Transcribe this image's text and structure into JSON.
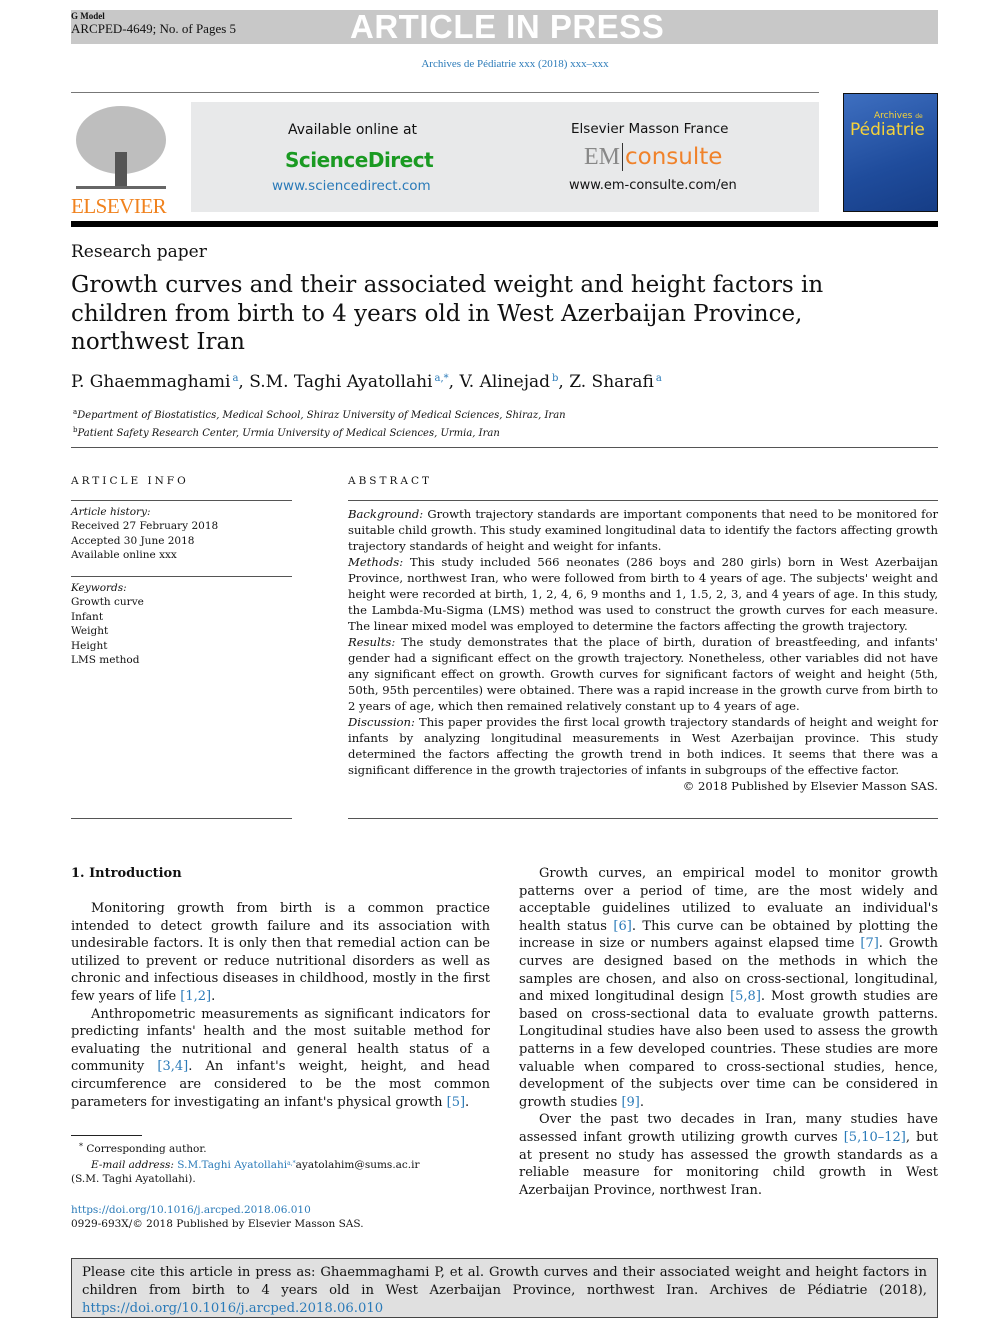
{
  "header": {
    "g_model": "G Model",
    "code": "ARCPED-4649; No. of Pages 5",
    "banner": "ARTICLE IN PRESS",
    "journal_line": "Archives de Pédiatrie xxx (2018) xxx–xxx"
  },
  "masthead": {
    "publisher_logo": "ELSEVIER",
    "available": "Available online at",
    "sciencedirect": "ScienceDirect",
    "sd_url": "www.sciencedirect.com",
    "masson": "Elsevier Masson France",
    "em": "EM",
    "consulte": "consulte",
    "em_url": "www.em-consulte.com/en",
    "cover_title_1": "Archives",
    "cover_title_de": "de",
    "cover_title_2": "Pédiatrie",
    "colors": {
      "sciencedirect": "#1a9a22",
      "link": "#2a7ab8",
      "consulte": "#f0822a",
      "elsevier": "#f0821e"
    }
  },
  "article": {
    "type": "Research paper",
    "title": "Growth curves and their associated weight and height factors in children from birth to 4 years old in West Azerbaijan Province, northwest Iran",
    "authors": [
      {
        "name": "P. Ghaemmaghami",
        "sup": "a"
      },
      {
        "name": "S.M. Taghi Ayatollahi",
        "sup": "a,*"
      },
      {
        "name": "V. Alinejad",
        "sup": "b"
      },
      {
        "name": "Z. Sharafi",
        "sup": "a"
      }
    ],
    "affiliations": [
      {
        "sup": "a",
        "text": "Department of Biostatistics, Medical School, Shiraz University of Medical Sciences, Shiraz, Iran"
      },
      {
        "sup": "b",
        "text": "Patient Safety Research Center, Urmia University of Medical Sciences, Urmia, Iran"
      }
    ]
  },
  "info": {
    "heading": "ARTICLE INFO",
    "history_label": "Article history:",
    "history": [
      "Received 27 February 2018",
      "Accepted 30 June 2018",
      "Available online xxx"
    ],
    "keywords_label": "Keywords:",
    "keywords": [
      "Growth curve",
      "Infant",
      "Weight",
      "Height",
      "LMS method"
    ]
  },
  "abstract": {
    "heading": "ABSTRACT",
    "sections": [
      {
        "label": "Background:",
        "text": " Growth trajectory standards are important components that need to be monitored for suitable child growth. This study examined longitudinal data to identify the factors affecting growth trajectory standards of height and weight for infants."
      },
      {
        "label": "Methods:",
        "text": " This study included 566 neonates (286 boys and 280 girls) born in West Azerbaijan Province, northwest Iran, who were followed from birth to 4 years of age. The subjects' weight and height were recorded at birth, 1, 2, 4, 6, 9 months and 1, 1.5, 2, 3, and 4 years of age. In this study, the Lambda-Mu-Sigma (LMS) method was used to construct the growth curves for each measure. The linear mixed model was employed to determine the factors affecting the growth trajectory."
      },
      {
        "label": "Results:",
        "text": " The study demonstrates that the place of birth, duration of breastfeeding, and infants' gender had a significant effect on the growth trajectory. Nonetheless, other variables did not have any significant effect on growth. Growth curves for significant factors of weight and height (5th, 50th, 95th percentiles) were obtained. There was a rapid increase in the growth curve from birth to 2 years of age, which then remained relatively constant up to 4 years of age."
      },
      {
        "label": "Discussion:",
        "text": " This paper provides the first local growth trajectory standards of height and weight for infants by analyzing longitudinal measurements in West Azerbaijan province. This study determined the factors affecting the growth trend in both indices. It seems that there was a significant difference in the growth trajectories of infants in subgroups of the effective factor."
      }
    ],
    "copyright": "© 2018 Published by Elsevier Masson SAS."
  },
  "intro": {
    "heading": "1.  Introduction",
    "p1": "Monitoring growth from birth is a common practice intended to detect growth failure and its association with undesirable factors. It is only then that remedial action can be utilized to prevent or reduce nutritional disorders as well as chronic and infectious diseases in childhood, mostly in the first few years of life ",
    "p1_ref": "[1,2]",
    "p2": "Anthropometric measurements as significant indicators for predicting infants' health and the most suitable method for evaluating the nutritional and general health status of a community ",
    "p2_ref": "[3,4]",
    "p2b": ". An infant's weight, height, and head circumference are considered to be the most common parameters for investigating an infant's physical growth ",
    "p2_ref2": "[5]",
    "p3a": "Growth curves, an empirical model to monitor growth patterns over a period of time, are the most widely and acceptable guidelines utilized to evaluate an individual's health status ",
    "p3_ref1": "[6]",
    "p3b": ". This curve can be obtained by plotting the increase in size or numbers against elapsed time ",
    "p3_ref2": "[7]",
    "p3c": ". Growth curves are designed based on the methods in which the samples are chosen, and also on cross-sectional, longitudinal, and mixed longitudinal design ",
    "p3_ref3": "[5,8]",
    "p3d": ". Most growth studies are based on cross-sectional data to evaluate growth patterns. Longitudinal studies have also been used to assess the growth patterns in a few developed countries. These studies are more valuable when compared to cross-sectional studies, hence, development of the subjects over time can be considered in growth studies ",
    "p3_ref4": "[9]",
    "p4a": "Over the past two decades in Iran, many studies have assessed infant growth utilizing growth curves ",
    "p4_ref": "[5,10–12]",
    "p4b": ", but at present no study has assessed the growth standards as a reliable measure for monitoring child growth in West Azerbaijan Province, northwest Iran."
  },
  "footnote": {
    "star": "*",
    "corresponding": "Corresponding author.",
    "email_label": "E-mail address:",
    "email_name": "S.M.Taghi Ayatollahi",
    "email_sup": "a,*",
    "email": "ayatolahim@sums.ac.ir",
    "email_person": "(S.M. Taghi Ayatollahi).",
    "doi": "https://doi.org/10.1016/j.arcped.2018.06.010",
    "issn": "0929-693X/© 2018 Published by Elsevier Masson SAS."
  },
  "citation": {
    "text": "Please cite this article in press as: Ghaemmaghami P, et al. Growth curves and their associated weight and height factors in children from birth to 4 years old in West Azerbaijan Province, northwest Iran. Archives de Pédiatrie (2018), ",
    "doi": "https://doi.org/10.1016/j.arcped.2018.06.010"
  }
}
